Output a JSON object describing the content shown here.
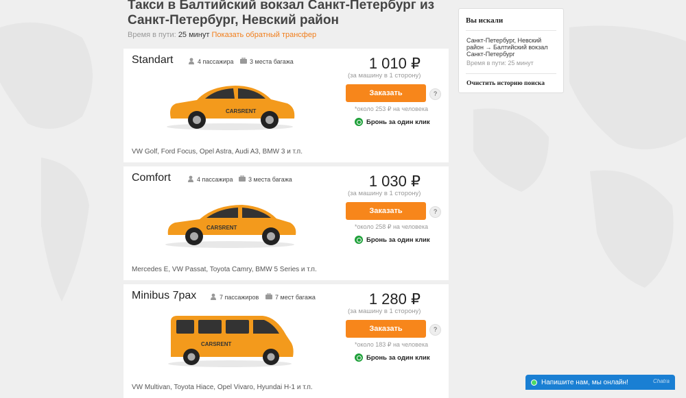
{
  "page": {
    "title": "Такси в Балтийский вокзал Санкт-Петербург из Санкт-Петербург, Невский район",
    "travel_label": "Время в пути:",
    "travel_time": "25 минут",
    "reverse_link": "Показать обратный трансфер"
  },
  "cards": [
    {
      "name": "Standart",
      "passengers": "4 пассажира",
      "luggage": "3 места багажа",
      "price": "1 010 ₽",
      "per_car": "(за машину в 1 сторону)",
      "order_label": "Заказать",
      "help": "?",
      "per_person": "*около 253 ₽ на человека",
      "whatsapp": "Бронь за один клик",
      "models": "VW Golf, Ford Focus, Opel Astra, Audi A3, BMW 3 и т.п.",
      "car_text": "CARSRENT"
    },
    {
      "name": "Comfort",
      "passengers": "4 пассажира",
      "luggage": "3 места багажа",
      "price": "1 030 ₽",
      "per_car": "(за машину в 1 сторону)",
      "order_label": "Заказать",
      "help": "?",
      "per_person": "*около 258 ₽ на человека",
      "whatsapp": "Бронь за один клик",
      "models": "Mercedes E, VW Passat, Toyota Camry, BMW 5 Series и т.п.",
      "car_text": "CARSRENT"
    },
    {
      "name": "Minibus 7pax",
      "passengers": "7 пассажиров",
      "luggage": "7 мест багажа",
      "price": "1 280 ₽",
      "per_car": "(за машину в 1 сторону)",
      "order_label": "Заказать",
      "help": "?",
      "per_person": "*около 183 ₽ на человека",
      "whatsapp": "Бронь за один клик",
      "models": "VW Multivan, Toyota Hiace, Opel Vivaro, Hyundai H-1 и т.п.",
      "car_text": "CARSRENT"
    }
  ],
  "sidebar": {
    "heading": "Вы искали",
    "route": "Санкт-Петербург, Невский район → Балтийский вокзал Санкт-Петербург",
    "time": "Время в пути: 25 минут",
    "clear": "Очистить историю поиска"
  },
  "chat": {
    "label": "Напишите нам, мы онлайн!",
    "brand": "Chatra"
  },
  "colors": {
    "accent": "#f7861b",
    "link": "#f07d1a",
    "whatsapp": "#1fa03a",
    "chat": "#1a7fd3"
  }
}
